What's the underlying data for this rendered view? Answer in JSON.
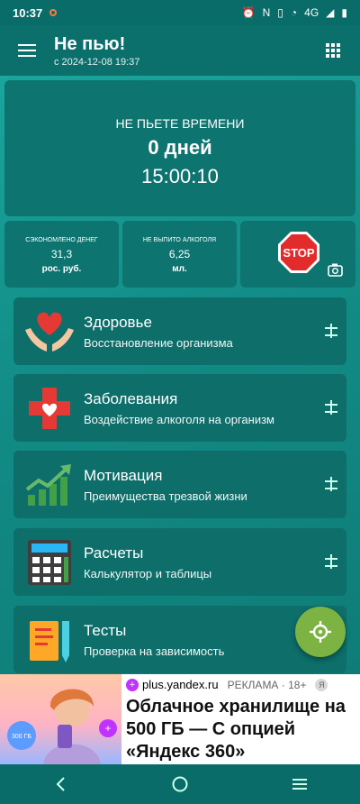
{
  "status_bar": {
    "time": "10:37",
    "network": "4G"
  },
  "app_bar": {
    "title": "Не пью!",
    "subtitle": "с 2024-12-08 19:37"
  },
  "timer": {
    "label": "НЕ ПЬЕТЕ ВРЕМЕНИ",
    "days": "0 дней",
    "clock": "15:00:10"
  },
  "stats": [
    {
      "label": "СЭКОНОМЛЕНО ДЕНЕГ",
      "value": "31,3",
      "unit": "рос. руб."
    },
    {
      "label": "НЕ ВЫПИТО АЛКОГОЛЯ",
      "value": "6,25",
      "unit": "мл."
    }
  ],
  "stop_sign_text": "STOP",
  "cards": [
    {
      "title": "Здоровье",
      "subtitle": "Восстановление организма"
    },
    {
      "title": "Заболевания",
      "subtitle": "Воздействие алкоголя на организм"
    },
    {
      "title": "Мотивация",
      "subtitle": "Преимущества трезвой жизни"
    },
    {
      "title": "Расчеты",
      "subtitle": "Калькулятор и таблицы"
    },
    {
      "title": "Тесты",
      "subtitle": "Проверка на зависимость"
    }
  ],
  "ad": {
    "domain": "plus.yandex.ru",
    "label": "РЕКЛАМА · 18+",
    "headline": "Облачное хранилище на 500 ГБ — С опцией «Яндекс 360»",
    "image_badge": "300 ГБ"
  },
  "colors": {
    "accent": "#0f7d78",
    "fab": "#7cb342",
    "stop": "#e32b2b"
  }
}
